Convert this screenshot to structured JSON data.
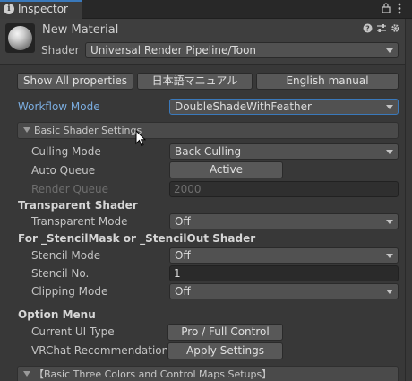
{
  "window": {
    "tab_label": "Inspector",
    "lock_icon": "lock-icon",
    "menu_icon": "kebab-menu-icon"
  },
  "material": {
    "name": "New Material",
    "shader_label": "Shader",
    "shader_value": "Universal Render Pipeline/Toon",
    "header_icons": [
      "help-icon",
      "presets-icon",
      "settings-gear-icon"
    ]
  },
  "top_buttons": {
    "show_all": "Show All properties",
    "japanese_manual": "日本語マニュアル",
    "english_manual": "English manual"
  },
  "workflow": {
    "label": "Workflow Mode",
    "value": "DoubleShadeWithFeather"
  },
  "basic_shader_settings": {
    "header": "Basic Shader Settings",
    "culling_mode": {
      "label": "Culling Mode",
      "value": "Back Culling"
    },
    "auto_queue": {
      "label": "Auto Queue",
      "value": "Active"
    },
    "render_queue": {
      "label": "Render Queue",
      "value": "2000"
    },
    "transparent_heading": "Transparent Shader",
    "transparent_mode": {
      "label": "Transparent Mode",
      "value": "Off"
    },
    "stencil_heading": "For _StencilMask or _StencilOut Shader",
    "stencil_mode": {
      "label": "Stencil Mode",
      "value": "Off"
    },
    "stencil_no": {
      "label": "Stencil No.",
      "value": "1"
    },
    "clipping_mode": {
      "label": "Clipping Mode",
      "value": "Off"
    }
  },
  "option_menu": {
    "heading": "Option Menu",
    "current_ui_type": {
      "label": "Current UI Type",
      "value": "Pro / Full Control"
    },
    "vrchat": {
      "label": "VRChat Recommendation",
      "value": "Apply Settings"
    }
  },
  "next_section": {
    "header": "【Basic Three Colors and Control Maps Setups】"
  },
  "colors": {
    "background": "#383838",
    "accent_blue": "#7bade0",
    "focus_border": "#3a79bb"
  }
}
